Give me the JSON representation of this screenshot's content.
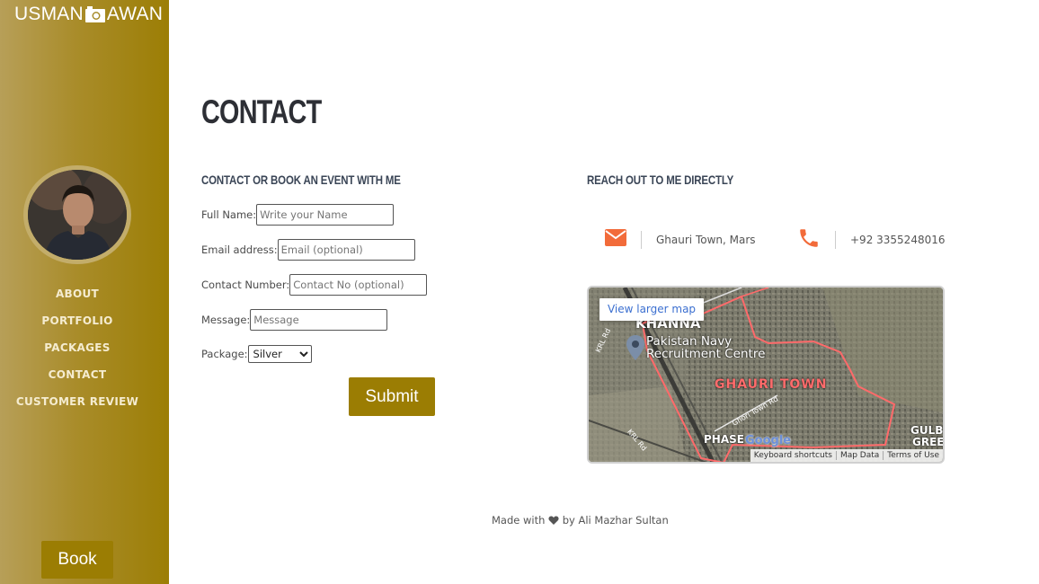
{
  "brand": {
    "left": "USMAN",
    "right": "AWAN",
    "icon": "camera-icon"
  },
  "nav": {
    "items": [
      {
        "label": "ABOUT"
      },
      {
        "label": "PORTFOLIO"
      },
      {
        "label": "PACKAGES"
      },
      {
        "label": "CONTACT"
      },
      {
        "label": "CUSTOMER REVIEW"
      }
    ]
  },
  "sidebar": {
    "book_label": "Book"
  },
  "page": {
    "title": "CONTACT"
  },
  "form": {
    "heading": "CONTACT OR BOOK AN EVENT WITH ME",
    "full_name": {
      "label": "Full Name:",
      "placeholder": "Write your Name"
    },
    "email": {
      "label": "Email address:",
      "placeholder": "Email (optional)"
    },
    "contact_no": {
      "label": "Contact Number:",
      "placeholder": "Contact No (optional)"
    },
    "message": {
      "label": "Message:",
      "placeholder": "Message"
    },
    "package": {
      "label": "Package:",
      "selected": "Silver"
    },
    "submit_label": "Submit"
  },
  "reach": {
    "heading": "REACH OUT TO ME DIRECTLY",
    "address": "Ghauri Town, Mars",
    "phone": "+92 3355248016",
    "accent": "#f26b3a"
  },
  "map": {
    "view_larger": "View larger map",
    "labels": {
      "khanna": "KHANNA",
      "place": "Pakistan Navy Recruitment Centre",
      "area": "GHAURI TOWN",
      "phase": "PHASE",
      "gulb": "GULB",
      "gree": "GREE",
      "krl_rd_1": "KRL Rd",
      "krl_rd_2": "KRL Rd",
      "ghori_town_rd": "Ghori Town Rd",
      "google": "Google"
    },
    "footer": {
      "shortcuts": "Keyboard shortcuts",
      "map_data": "Map Data",
      "terms": "Terms of Use"
    }
  },
  "footer": {
    "made_with": "Made with",
    "by": "by Ali Mazhar Sultan"
  },
  "colors": {
    "brand_gold": "#9b7d03",
    "sidebar_light": "#b79f58",
    "accent_orange": "#f26b3a"
  }
}
